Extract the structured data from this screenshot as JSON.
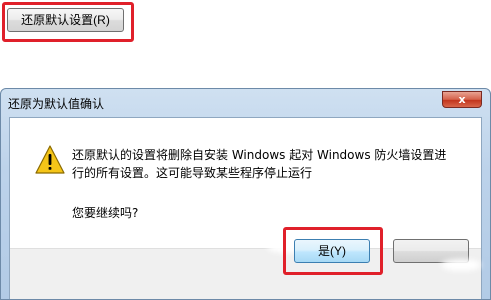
{
  "top_button": {
    "label": "还原默认设置(R)"
  },
  "dialog": {
    "title": "还原为默认值确认",
    "close_glyph": "x",
    "message_line1": "还原默认的设置将删除自安装 Windows 起对 Windows 防火墙设置进",
    "message_line2": "行的所有设置。这可能导致某些程序停止运行",
    "question": "您要继续吗?",
    "yes_label": "是(Y)",
    "no_label": "",
    "icon": "warning-icon"
  },
  "colors": {
    "highlight": "#e0202a",
    "title_gradient_top": "#cfe0f1",
    "close_button": "#c2351d",
    "warning_yellow": "#f5c518"
  }
}
